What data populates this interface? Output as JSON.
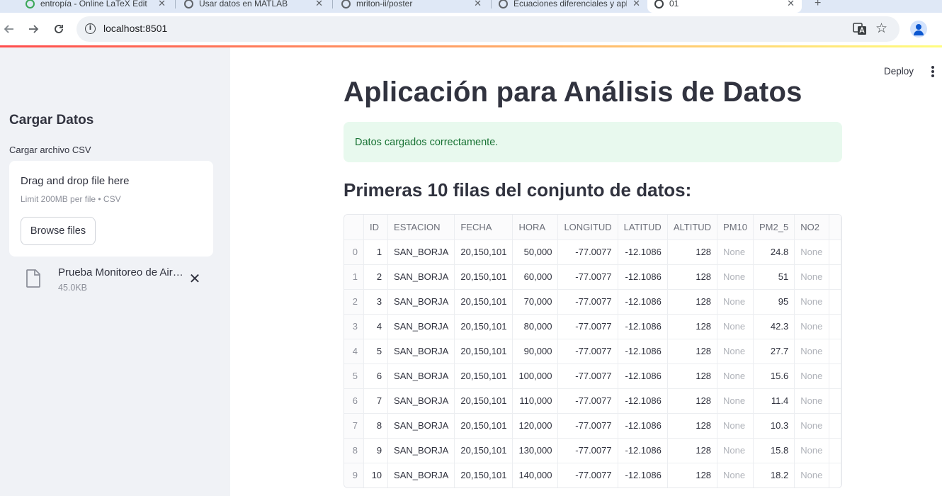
{
  "browser": {
    "tabs": [
      {
        "title": "entropía - Online LaTeX Edit",
        "icon": "overleaf-icon"
      },
      {
        "title": "Usar datos en MATLAB",
        "icon": "mathworks-icon"
      },
      {
        "title": "mriton-ii/poster",
        "icon": "github-icon"
      },
      {
        "title": "Ecuaciones diferenciales y apl",
        "icon": "globe-icon"
      },
      {
        "title": "01",
        "icon": "streamlit-icon",
        "active": true
      }
    ],
    "url": "localhost:8501"
  },
  "sidebar": {
    "header": "Cargar Datos",
    "uploader_label": "Cargar archivo CSV",
    "dropzone_title": "Drag and drop file here",
    "dropzone_limit": "Limit 200MB per file • CSV",
    "browse_label": "Browse files",
    "file": {
      "name": "Prueba Monitoreo de Aire.csv",
      "size": "45.0KB"
    }
  },
  "header": {
    "deploy_label": "Deploy"
  },
  "main": {
    "title": "Aplicación para Análisis de Datos",
    "success_message": "Datos cargados correctamente.",
    "subheader": "Primeras 10 filas del conjunto de datos:",
    "table": {
      "columns": [
        "",
        "ID",
        "ESTACION",
        "FECHA",
        "HORA",
        "LONGITUD",
        "LATITUD",
        "ALTITUD",
        "PM10",
        "PM2_5",
        "NO2"
      ],
      "rows": [
        [
          "0",
          "1",
          "SAN_BORJA",
          "20,150,101",
          "50,000",
          "-77.0077",
          "-12.1086",
          "128",
          "None",
          "24.8",
          "None"
        ],
        [
          "1",
          "2",
          "SAN_BORJA",
          "20,150,101",
          "60,000",
          "-77.0077",
          "-12.1086",
          "128",
          "None",
          "51",
          "None"
        ],
        [
          "2",
          "3",
          "SAN_BORJA",
          "20,150,101",
          "70,000",
          "-77.0077",
          "-12.1086",
          "128",
          "None",
          "95",
          "None"
        ],
        [
          "3",
          "4",
          "SAN_BORJA",
          "20,150,101",
          "80,000",
          "-77.0077",
          "-12.1086",
          "128",
          "None",
          "42.3",
          "None"
        ],
        [
          "4",
          "5",
          "SAN_BORJA",
          "20,150,101",
          "90,000",
          "-77.0077",
          "-12.1086",
          "128",
          "None",
          "27.7",
          "None"
        ],
        [
          "5",
          "6",
          "SAN_BORJA",
          "20,150,101",
          "100,000",
          "-77.0077",
          "-12.1086",
          "128",
          "None",
          "15.6",
          "None"
        ],
        [
          "6",
          "7",
          "SAN_BORJA",
          "20,150,101",
          "110,000",
          "-77.0077",
          "-12.1086",
          "128",
          "None",
          "11.4",
          "None"
        ],
        [
          "7",
          "8",
          "SAN_BORJA",
          "20,150,101",
          "120,000",
          "-77.0077",
          "-12.1086",
          "128",
          "None",
          "10.3",
          "None"
        ],
        [
          "8",
          "9",
          "SAN_BORJA",
          "20,150,101",
          "130,000",
          "-77.0077",
          "-12.1086",
          "128",
          "None",
          "15.8",
          "None"
        ],
        [
          "9",
          "10",
          "SAN_BORJA",
          "20,150,101",
          "140,000",
          "-77.0077",
          "-12.1086",
          "128",
          "None",
          "18.2",
          "None"
        ]
      ]
    }
  },
  "colors": {
    "accent_red": "#ff4b4b",
    "sidebar_bg": "#f0f2f6",
    "success_bg": "#e8f9ee",
    "success_text": "#177233"
  }
}
